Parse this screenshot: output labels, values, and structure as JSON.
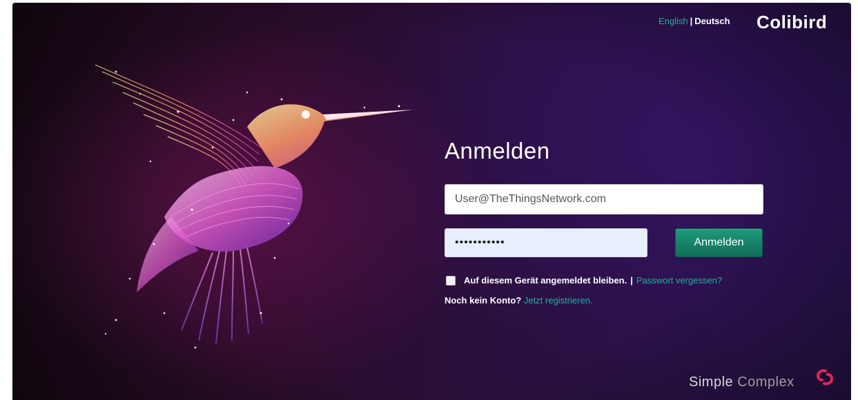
{
  "header": {
    "lang_english": "English",
    "lang_separator": "|",
    "lang_deutsch": "Deutsch",
    "brand": "Colibird"
  },
  "login": {
    "title": "Anmelden",
    "email_value": "User@TheThingsNetwork.com",
    "password_value": "•••••••••••",
    "submit_label": "Anmelden",
    "remember_label": "Auf diesem Gerät angemeldet bleiben.",
    "separator": "|",
    "forgot_link": "Passwort vergessen?",
    "no_account": "Noch kein Konto?",
    "register_link": "Jetzt registrieren."
  },
  "footer": {
    "brand_simple": "Simple",
    "brand_complex": "Complex"
  },
  "colors": {
    "accent_teal": "#1fb39a",
    "button_green": "#0f6e56",
    "logo_red": "#e5245a"
  },
  "icons": {
    "hero": "hummingbird-illustration",
    "footer_logo": "simple-complex-logo-icon"
  }
}
